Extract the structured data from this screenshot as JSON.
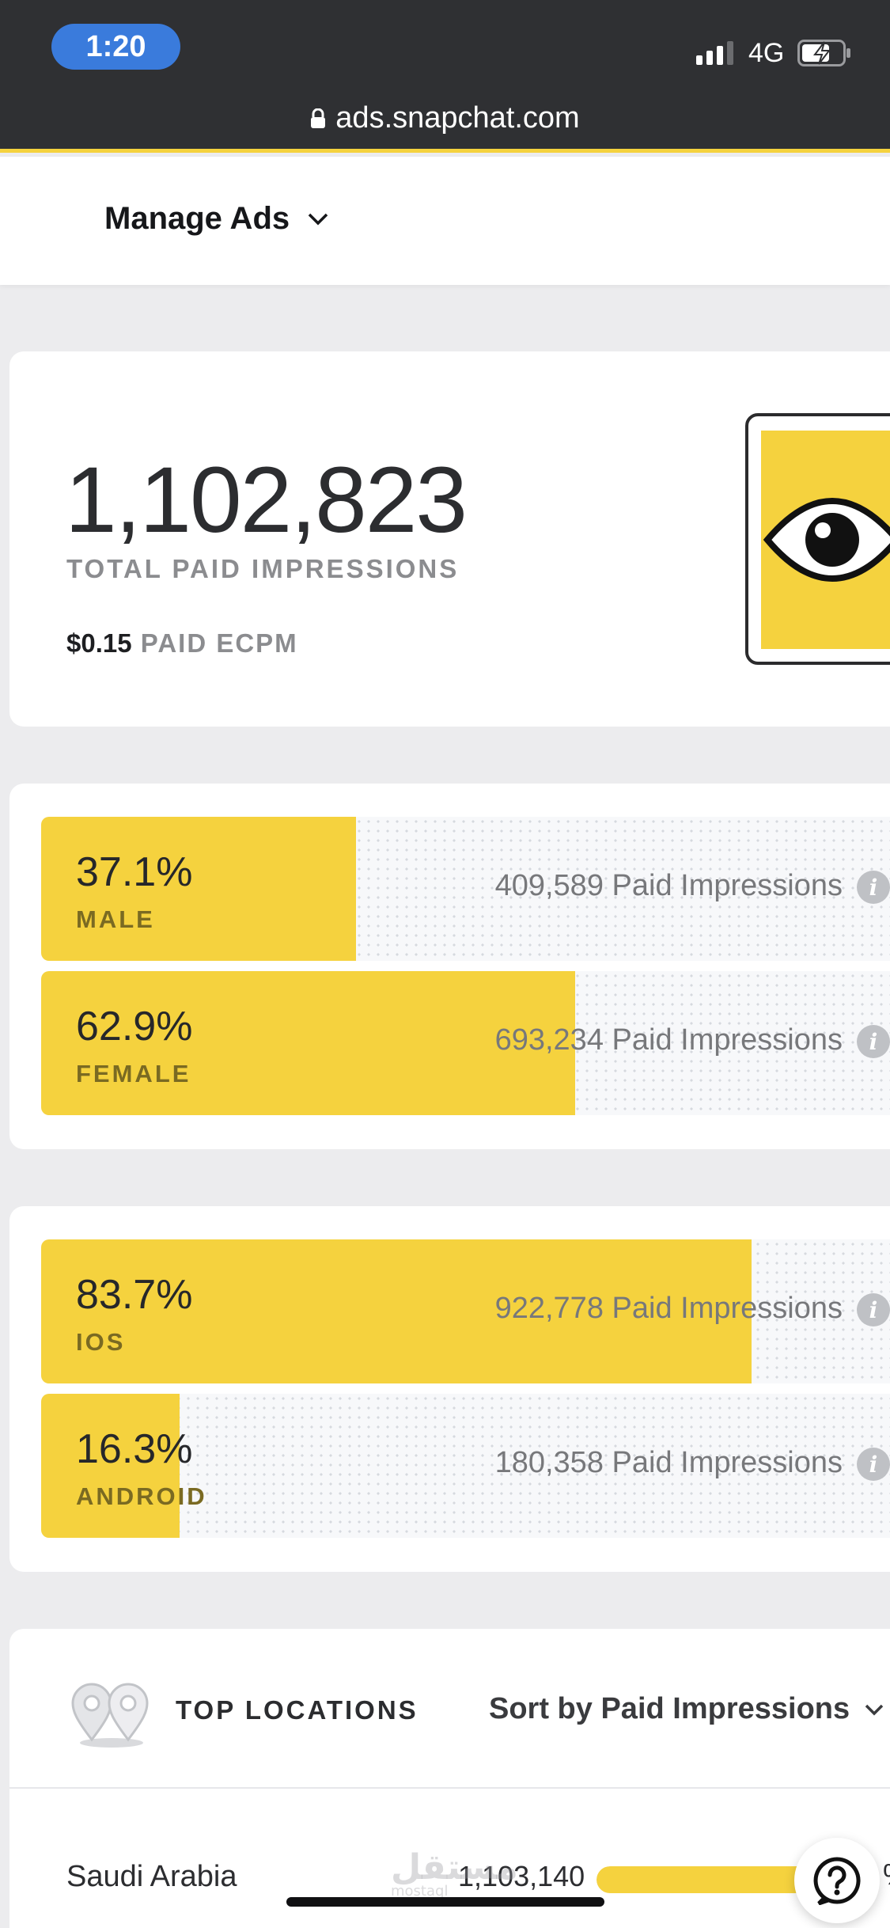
{
  "status_bar": {
    "time": "1:20",
    "network": "4G"
  },
  "browser": {
    "url": "ads.snapchat.com"
  },
  "header": {
    "menu_label": "Manage Ads"
  },
  "summary": {
    "total_value": "1,102,823",
    "total_label": "TOTAL PAID IMPRESSIONS",
    "ecpm_value": "$0.15",
    "ecpm_label": "PAID ECPM"
  },
  "gender": [
    {
      "pct": "37.1%",
      "label": "MALE",
      "impressions": "409,589",
      "imp_label": "Paid Impressions",
      "share": 0.371
    },
    {
      "pct": "62.9%",
      "label": "FEMALE",
      "impressions": "693,234",
      "imp_label": "Paid Impressions",
      "share": 0.629
    }
  ],
  "platform": [
    {
      "pct": "83.7%",
      "label": "IOS",
      "impressions": "922,778",
      "imp_label": "Paid Impressions",
      "share": 0.837
    },
    {
      "pct": "16.3%",
      "label": "ANDROID",
      "impressions": "180,358",
      "imp_label": "Paid Impressions",
      "share": 0.163
    }
  ],
  "locations": {
    "title": "TOP LOCATIONS",
    "sort_label": "Sort by Paid Impressions",
    "rows": [
      {
        "name": "Saudi Arabia",
        "value": "1,103,140",
        "pct": "%",
        "share": 1.0
      }
    ]
  },
  "watermark": {
    "text": "مستقل",
    "sub": "mostaql"
  },
  "colors": {
    "accent": "#f5d23e",
    "chrome": "#2f3033",
    "time_pill": "#3a7bdc"
  }
}
